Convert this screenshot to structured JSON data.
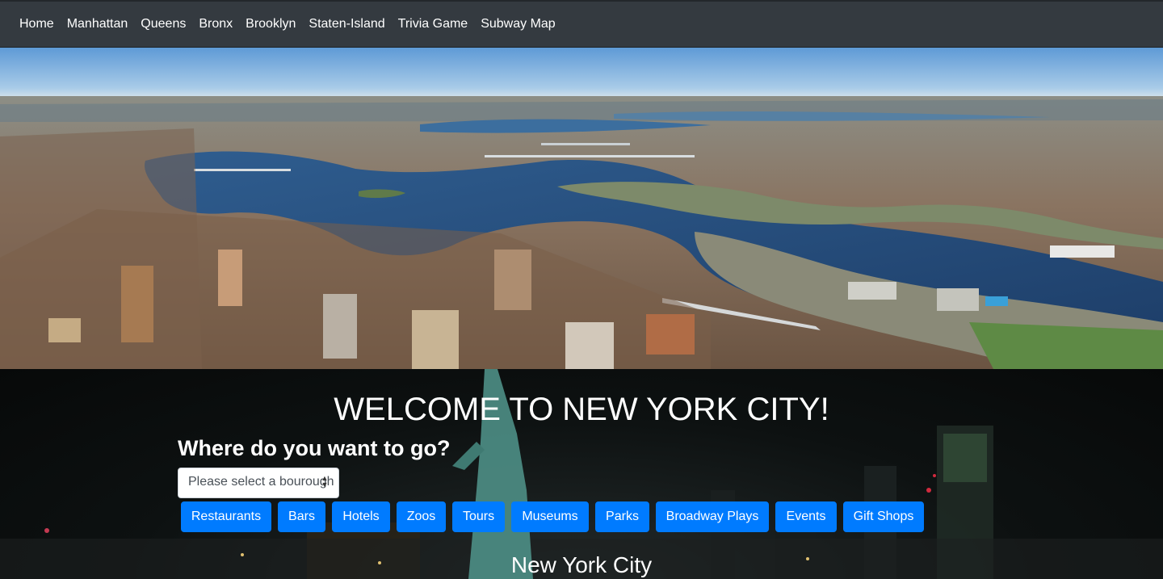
{
  "navbar": {
    "items": [
      "Home",
      "Manhattan",
      "Queens",
      "Bronx",
      "Brooklyn",
      "Staten-Island",
      "Trivia Game",
      "Subway Map"
    ]
  },
  "hero": {
    "image": "aerial view of New York City East River with bridges"
  },
  "main": {
    "title": "WELCOME TO NEW YORK CITY!",
    "question": "Where do you want to go?",
    "borough_select": {
      "value": "Please select a bourough"
    },
    "categories": [
      "Restaurants",
      "Bars",
      "Hotels",
      "Zoos",
      "Tours",
      "Museums",
      "Parks",
      "Broadway Plays",
      "Events",
      "Gift Shops"
    ],
    "section_title": "New York City"
  },
  "colors": {
    "navbar_bg": "#343a40",
    "button_primary": "#007bff"
  }
}
